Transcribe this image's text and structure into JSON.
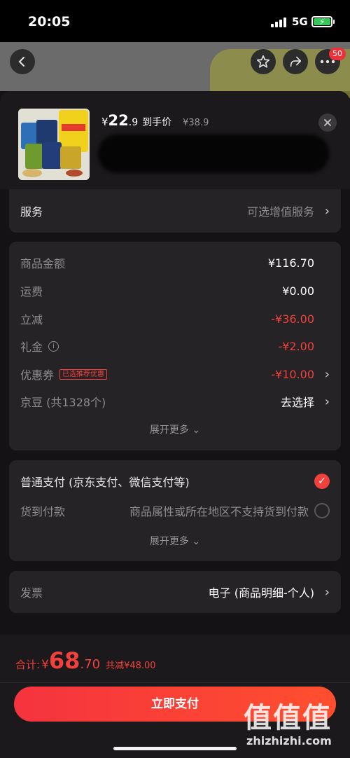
{
  "status_bar": {
    "time": "20:05",
    "network": "5G"
  },
  "header": {
    "badge_count": "50"
  },
  "product": {
    "price_currency": "¥",
    "price_int": "22",
    "price_dec": ".9",
    "price_label": "到手价",
    "original_price": "¥38.9"
  },
  "service": {
    "label": "服务",
    "value": "可选增值服务"
  },
  "amounts": {
    "rows": [
      {
        "label": "商品金额",
        "value": "¥116.70"
      },
      {
        "label": "运费",
        "value": "¥0.00"
      },
      {
        "label": "立减",
        "value": "-¥36.00"
      },
      {
        "label": "礼金",
        "value": "-¥2.00"
      },
      {
        "label": "优惠券",
        "tag": "已选推荐优惠",
        "value": "-¥10.00"
      },
      {
        "label": "京豆 (共1328个)",
        "value": "去选择"
      }
    ],
    "expand": "展开更多 ⌄"
  },
  "payment": {
    "option1": "普通支付 (京东支付、微信支付等)",
    "option2_label": "货到付款",
    "option2_note": "商品属性或所在地区不支持货到付款",
    "expand": "展开更多 ⌄"
  },
  "invoice": {
    "label": "发票",
    "value": "电子 (商品明细-个人)"
  },
  "footer": {
    "total_label": "合计:",
    "total_currency": "¥",
    "total_int": "68",
    "total_dec": ".70",
    "saved": "共减¥48.00",
    "pay_button": "立即支付"
  },
  "watermark": {
    "big": "值值值",
    "small": "zhizhizhi.com"
  },
  "colors": {
    "accent": "#f0413c",
    "card": "#252325",
    "background": "#141214"
  }
}
